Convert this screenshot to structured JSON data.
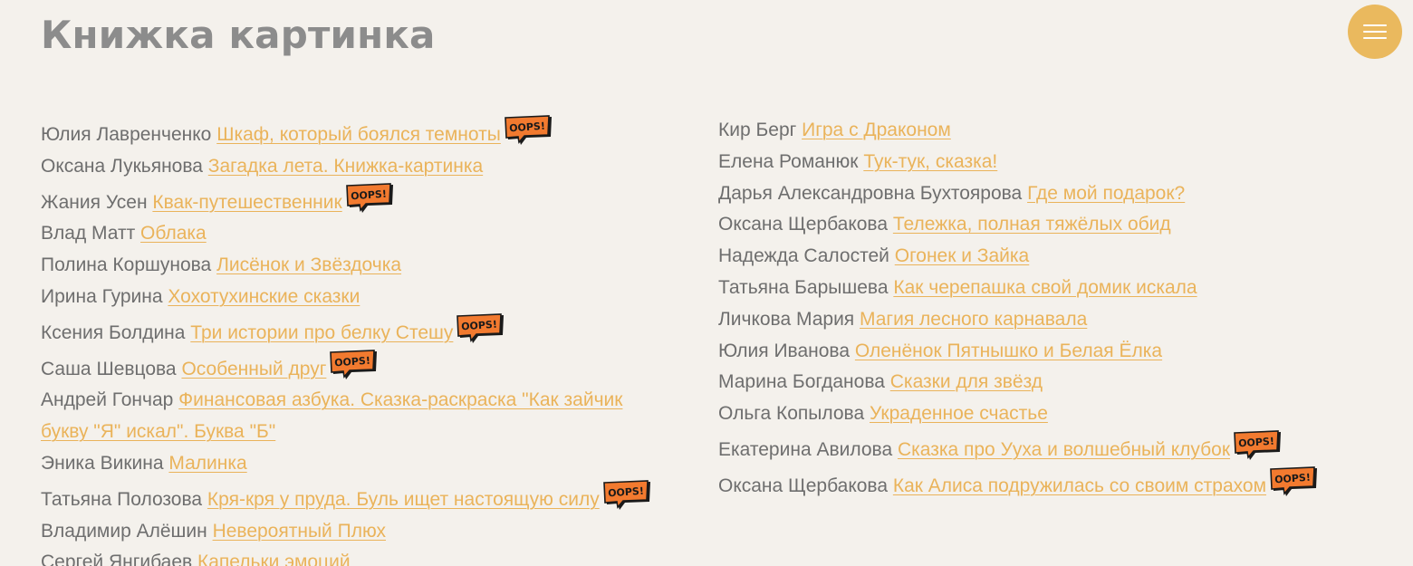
{
  "header": {
    "title": "Книжка картинка",
    "menu_icon": "hamburger-menu-icon",
    "accent_color": "#eab95e"
  },
  "badge": {
    "label": "OOPS!",
    "color": "#f27a2f"
  },
  "left_column": [
    {
      "author": "Юлия Лавренченко ",
      "title": "Шкаф, который боялся темноты",
      "oops": true
    },
    {
      "author": "Оксана Лукьянова ",
      "title": "Загадка лета. Книжка-картинка",
      "oops": false
    },
    {
      "author": "Жания Усен ",
      "title": "Квак-путешественник",
      "oops": true
    },
    {
      "author": "Влад Матт ",
      "title": "Облака",
      "oops": false
    },
    {
      "author": "Полина Коршунова  ",
      "title": "Лисёнок и Звёздочка",
      "oops": false
    },
    {
      "author": "Ирина Гурина ",
      "title": "Хохотухинские сказки",
      "oops": false
    },
    {
      "author": "Ксения Болдина ",
      "title": "Три истории про белку Стешу",
      "oops": true
    },
    {
      "author": "Саша Шевцова ",
      "title": "Особенный друг",
      "oops": true
    },
    {
      "author": "Андрей Гончар ",
      "title": "Финансовая азбука. Сказка-раскраска \"Как зайчик букву \"Я\" искал\". Буква \"Б\"",
      "oops": false
    },
    {
      "author": "Эника Викина ",
      "title": "Малинка",
      "oops": false
    },
    {
      "author": "Татьяна Полозова ",
      "title": "Кря-кря у пруда. Буль ищет настоящую силу",
      "oops": true
    },
    {
      "author": "Владимир Алёшин ",
      "title": "Невероятный Плюх",
      "oops": false
    },
    {
      "author": "Сергей Янгибаев ",
      "title": "Капельки эмоций",
      "oops": false
    }
  ],
  "right_column": [
    {
      "author": "Кир Берг ",
      "title": "Игра с Драконом",
      "oops": false
    },
    {
      "author": "Елена Романюк ",
      "title": "Тук-тук, сказка!",
      "oops": false
    },
    {
      "author": "Дарья Александровна Бухтоярова ",
      "title": "Где мой подарок?",
      "oops": false
    },
    {
      "author": "Оксана Щербакова ",
      "title": "Тележка, полная тяжёлых обид",
      "oops": false
    },
    {
      "author": "Надежда Салостей ",
      "title": "Огонек и Зайка",
      "oops": false
    },
    {
      "author": "Татьяна Барышева ",
      "title": "Как черепашка свой домик искала",
      "oops": false
    },
    {
      "author": "Личкова Мария ",
      "title": "Магия лесного карнавала",
      "oops": false
    },
    {
      "author": "Юлия Иванова ",
      "title": "Оленёнок Пятнышко и Белая Ёлка",
      "oops": false
    },
    {
      "author": "Марина Богданова ",
      "title": "Сказки для звёзд",
      "oops": false
    },
    {
      "author": "Ольга Копылова ",
      "title": "Украденное счастье",
      "oops": false
    },
    {
      "author": "Екатерина Авилова ",
      "title": "Сказка про Ууха и волшебный клубок",
      "oops": true
    },
    {
      "author": "Оксана Щербакова ",
      "title": "Как Алиса подружилась со своим страхом",
      "oops": true
    }
  ]
}
